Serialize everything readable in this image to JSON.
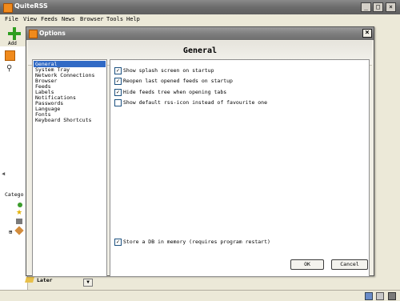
{
  "app": {
    "title": "QuiteRSS",
    "menu": [
      "File",
      "View",
      "Feeds",
      "News",
      "Browser",
      "Tools",
      "Help"
    ],
    "toolbar": {
      "add_label": "Add"
    },
    "categories_label": "Catego",
    "later_label": "Later",
    "window_controls": {
      "minimize": "_",
      "maximize": "□",
      "close": "×"
    }
  },
  "dialog": {
    "title": "Options",
    "close_glyph": "×",
    "header": "General",
    "categories": [
      "General",
      "System Tray",
      "Network Connections",
      "Browser",
      "Feeds",
      "Labels",
      "Notifications",
      "Passwords",
      "Language",
      "Fonts",
      "Keyboard Shortcuts"
    ],
    "selected_category": "General",
    "options": [
      {
        "label": "Show splash screen on startup",
        "checked": true
      },
      {
        "label": "Reopen last opened feeds on startup",
        "checked": true
      },
      {
        "label": "Hide feeds tree when opening tabs",
        "checked": true
      },
      {
        "label": "Show default rss-icon instead of favourite one",
        "checked": false
      }
    ],
    "bottom_option": {
      "label": "Store a DB in memory (requires program restart)",
      "checked": true
    },
    "ok_label": "OK",
    "cancel_label": "Cancel"
  },
  "colors": {
    "selection": "#316ac5",
    "add_icon": "#2e9e20",
    "app_icon": "#f08a1c"
  }
}
